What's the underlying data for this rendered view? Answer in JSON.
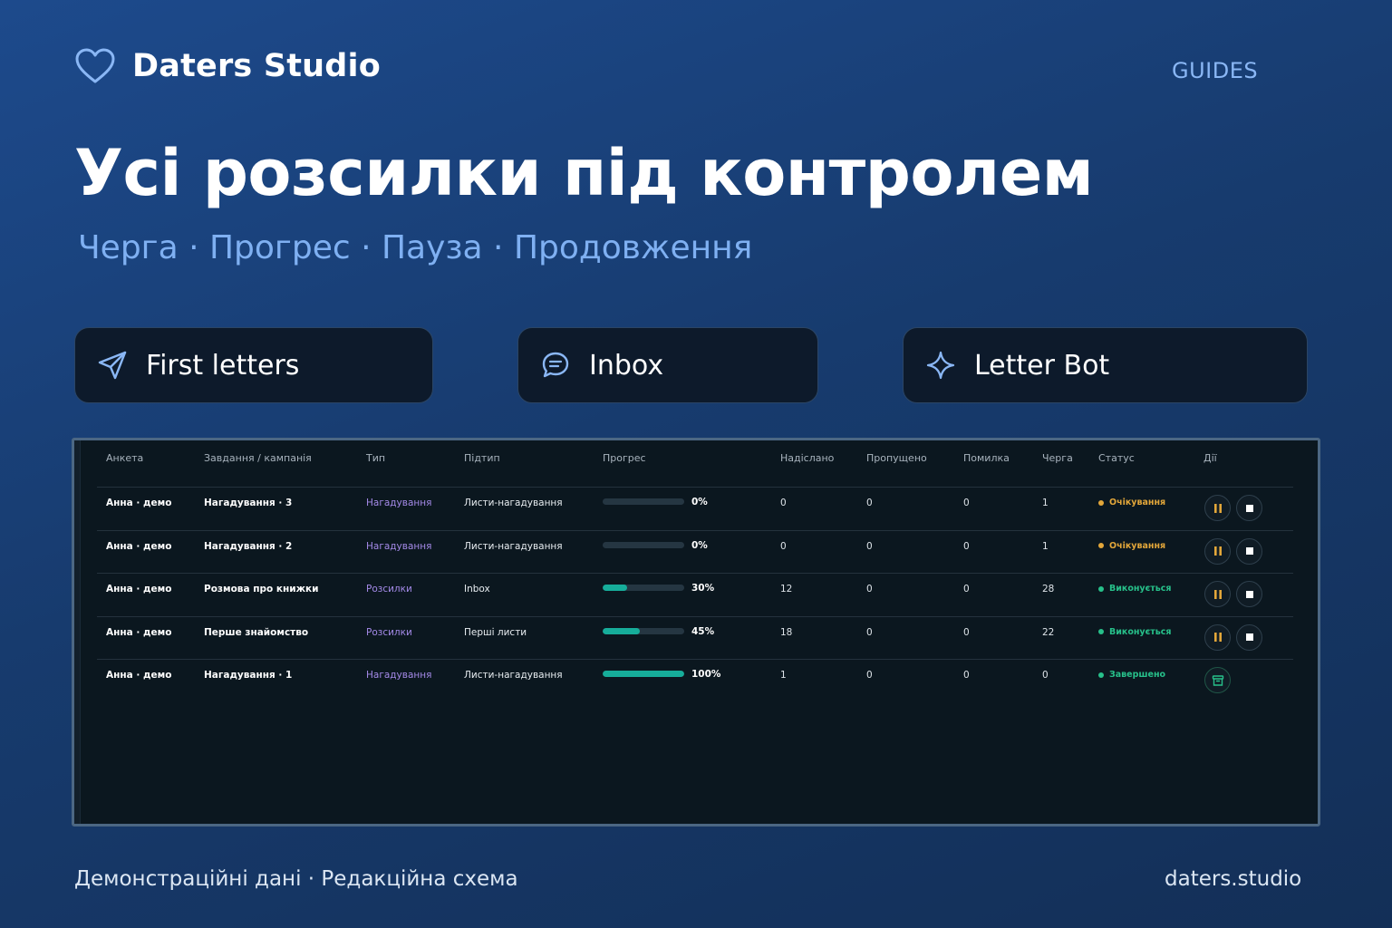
{
  "brand": {
    "name": "Daters Studio",
    "icon": "heart-icon",
    "icon_color": "#8ab7f5"
  },
  "nav": {
    "guides": "GUIDES"
  },
  "hero": {
    "title": "Усі розсилки під контролем",
    "subtitle": "Черга · Прогрес · Пауза · Продовження"
  },
  "features": [
    {
      "label": "First letters",
      "icon": "send-icon"
    },
    {
      "label": "Inbox",
      "icon": "chat-bubble-icon"
    },
    {
      "label": "Letter Bot",
      "icon": "sparkle-icon"
    }
  ],
  "table": {
    "headers": {
      "profile": "Анкета",
      "task": "Завдання / кампанія",
      "type": "Тип",
      "subtype": "Підтип",
      "progress": "Прогрес",
      "sent": "Надіслано",
      "skipped": "Пропущено",
      "error": "Помилка",
      "queue": "Черга",
      "status": "Статус",
      "actions": "Дії"
    },
    "rows": [
      {
        "profile": "Анна · демо",
        "task": "Нагадування · 3",
        "type": "Нагадування",
        "subtype": "Листи-нагадування",
        "progress": 0,
        "progress_label": "0%",
        "sent": "0",
        "skipped": "0",
        "error": "0",
        "queue": "1",
        "status": "Очікування",
        "status_color": "#e3a73a",
        "actions": [
          "pause-icon",
          "stop-icon"
        ]
      },
      {
        "profile": "Анна · демо",
        "task": "Нагадування · 2",
        "type": "Нагадування",
        "subtype": "Листи-нагадування",
        "progress": 0,
        "progress_label": "0%",
        "sent": "0",
        "skipped": "0",
        "error": "0",
        "queue": "1",
        "status": "Очікування",
        "status_color": "#e3a73a",
        "actions": [
          "pause-icon",
          "stop-icon"
        ]
      },
      {
        "profile": "Анна · демо",
        "task": "Розмова про книжки",
        "type": "Розсилки",
        "subtype": "Inbox",
        "progress": 30,
        "progress_label": "30%",
        "sent": "12",
        "skipped": "0",
        "error": "0",
        "queue": "28",
        "status": "Виконується",
        "status_color": "#27c08a",
        "actions": [
          "pause-icon",
          "stop-icon"
        ]
      },
      {
        "profile": "Анна · демо",
        "task": "Перше знайомство",
        "type": "Розсилки",
        "subtype": "Перші листи",
        "progress": 45,
        "progress_label": "45%",
        "sent": "18",
        "skipped": "0",
        "error": "0",
        "queue": "22",
        "status": "Виконується",
        "status_color": "#27c08a",
        "actions": [
          "pause-icon",
          "stop-icon"
        ]
      },
      {
        "profile": "Анна · демо",
        "task": "Нагадування · 1",
        "type": "Нагадування",
        "subtype": "Листи-нагадування",
        "progress": 100,
        "progress_label": "100%",
        "sent": "1",
        "skipped": "0",
        "error": "0",
        "queue": "0",
        "status": "Завершено",
        "status_color": "#27c08a",
        "actions": [
          "archive-icon"
        ]
      }
    ]
  },
  "footer": {
    "left": "Демонстраційні дані · Редакційна схема",
    "right": "daters.studio"
  },
  "colors": {
    "accent": "#8ab7f5",
    "progress_fill": "#16ad9a",
    "pause": "#e3a73a",
    "archive": "#27c08a"
  }
}
